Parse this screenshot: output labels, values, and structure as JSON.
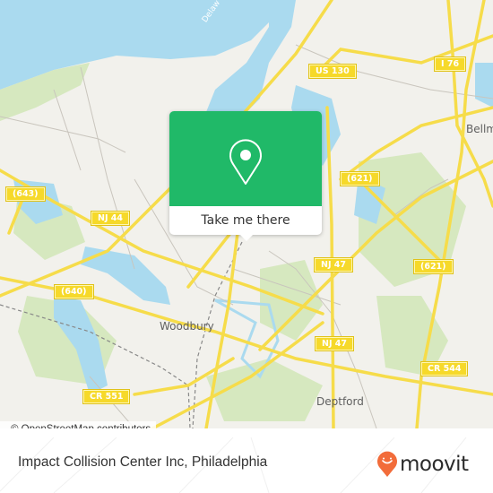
{
  "map": {
    "colors": {
      "water": "#aadaef",
      "land": "#f2f1ec",
      "park": "#d6e8bf",
      "road_major": "#f6dc4a",
      "road_minor": "#c9c5bd",
      "popup_green": "#20b968",
      "moovit_orange": "#f26c3a"
    },
    "place_labels": {
      "woodbury": "Woodbury",
      "deptford": "Deptford",
      "bellmawr": "Bellm",
      "delaware": "Delaw"
    },
    "road_shields": {
      "us130": "US 130",
      "i76": "I 76",
      "r621_top": "(621)",
      "r621_right": "(621)",
      "r643": "(643)",
      "nj44": "NJ 44",
      "r640": "(640)",
      "nj47_top": "NJ 47",
      "nj47_bottom": "NJ 47",
      "cr544": "CR 544",
      "cr551": "CR 551"
    },
    "attribution": "© OpenStreetMap contributors"
  },
  "popup": {
    "icon": "map-pin-icon",
    "cta_label": "Take me there"
  },
  "footer": {
    "title": "Impact Collision Center Inc, Philadelphia",
    "logo_icon": "moovit-face-pin-icon",
    "logo_text": "moovit"
  }
}
